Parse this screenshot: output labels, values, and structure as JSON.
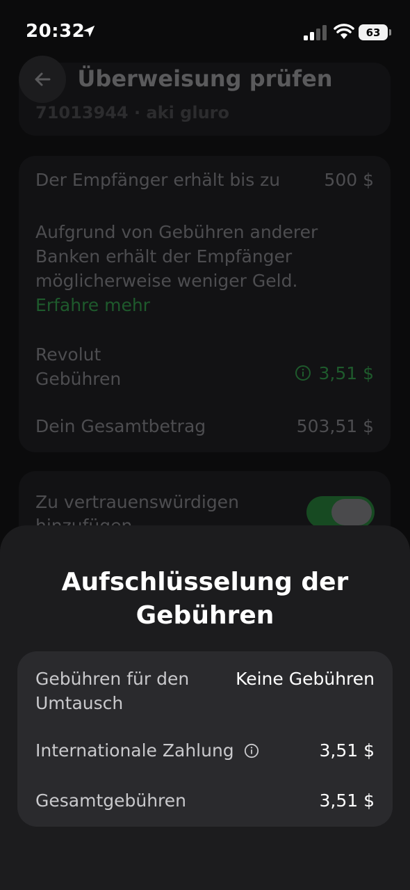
{
  "status_bar": {
    "time": "20:32",
    "battery": "63"
  },
  "header": {
    "title": "Überweisung prüfen"
  },
  "top_card": {
    "text": "71013944 · aki gluro"
  },
  "summary": {
    "recipient_label": "Der Empfänger erhält bis zu",
    "recipient_value": "500 $",
    "note": "Aufgrund von Gebühren anderer Banken erhält der Empfänger möglicherweise weniger Geld.",
    "learn_more": "Erfahre mehr",
    "fees_label": "Revolut Gebühren",
    "fees_value": "3,51 $",
    "total_label": "Dein Gesamtbetrag",
    "total_value": "503,51 $"
  },
  "trust": {
    "label": "Zu vertrauenswürdigen hinzufügen"
  },
  "sheet": {
    "title": "Aufschlüsselung der Gebühren",
    "rows": [
      {
        "label": "Gebühren für den Umtausch",
        "value": "Keine Gebühren"
      },
      {
        "label": "Internationale Zahlung",
        "value": "3,51 $"
      },
      {
        "label": "Gesamtgebühren",
        "value": "3,51 $"
      }
    ]
  },
  "colors": {
    "accent_green": "#1e5a2c",
    "sheet_bg": "#1c1c1e",
    "card_bg": "#2a2a2d"
  }
}
